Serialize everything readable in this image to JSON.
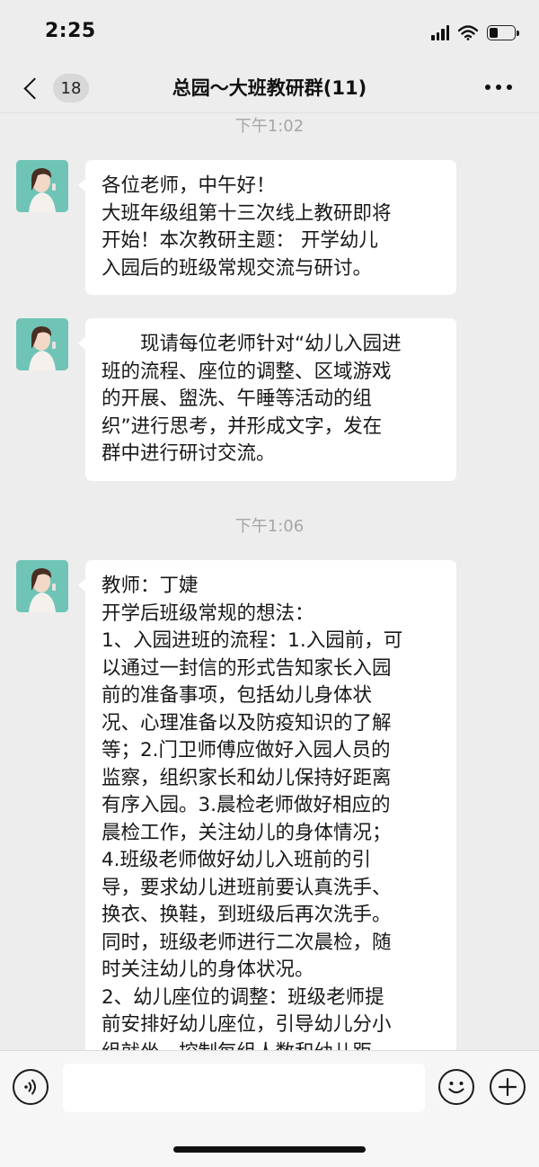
{
  "status_bar": {
    "time": "2:25"
  },
  "nav": {
    "unread_count": "18",
    "title": "总园～大班教研群(11)"
  },
  "messages": [
    {
      "timestamp": "下午1:02",
      "lines": [
        "各位老师，中午好！",
        "大班年级组第十三次线上教研即将",
        "开始！本次教研主题： 开学幼儿",
        "入园后的班级常规交流与研讨。"
      ]
    },
    {
      "lines": [
        "　　现请每位老师针对“幼儿入园进",
        "班的流程、座位的调整、区域游戏",
        "的开展、盥洗、午睡等活动的组",
        "织”进行思考，并形成文字，发在",
        "群中进行研讨交流。"
      ]
    },
    {
      "timestamp": "下午1:06",
      "lines": [
        "教师：丁婕",
        "开学后班级常规的想法：",
        "1、入园进班的流程：1.入园前，可",
        "以通过一封信的形式告知家长入园",
        "前的准备事项，包括幼儿身体状",
        "况、心理准备以及防疫知识的了解",
        "等；2.门卫师傅应做好入园人员的",
        "监察，组织家长和幼儿保持好距离",
        "有序入园。3.晨检老师做好相应的",
        "晨检工作，关注幼儿的身体情况；",
        "4.班级老师做好幼儿入班前的引",
        "导，要求幼儿进班前要认真洗手、",
        "换衣、换鞋，到班级后再次洗手。",
        "同时，班级老师进行二次晨检，随",
        "时关注幼儿的身体状况。",
        "2、幼儿座位的调整：班级老师提",
        "前安排好幼儿座位，引导幼儿分小",
        "组就坐，控制每组人数和幼儿距"
      ]
    }
  ],
  "input": {
    "placeholder": ""
  }
}
